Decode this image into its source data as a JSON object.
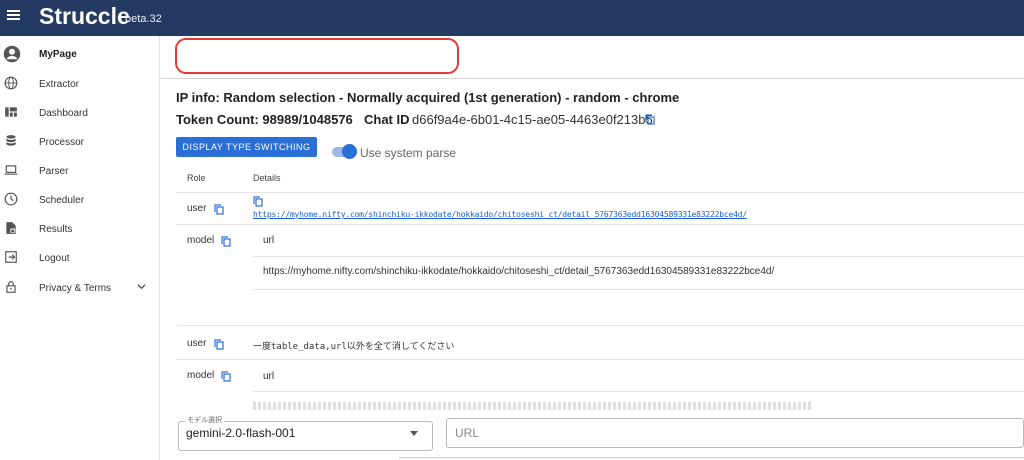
{
  "header": {
    "brand": "Struccle",
    "version": "beta.32",
    "menu_icon": "hamburger-icon"
  },
  "sidebar": {
    "items": [
      {
        "label": "MyPage",
        "icon": "account-circle-icon"
      },
      {
        "label": "Extractor",
        "icon": "globe-icon"
      },
      {
        "label": "Dashboard",
        "icon": "dashboard-icon"
      },
      {
        "label": "Processor",
        "icon": "database-icon"
      },
      {
        "label": "Parser",
        "icon": "laptop-icon"
      },
      {
        "label": "Scheduler",
        "icon": "clock-icon"
      },
      {
        "label": "Results",
        "icon": "file-lock-icon"
      },
      {
        "label": "Logout",
        "icon": "logout-icon"
      },
      {
        "label": "Privacy & Terms",
        "icon": "lock-icon"
      }
    ]
  },
  "main": {
    "ip_info": "IP info: Random selection - Normally acquired (1st generation) - random - chrome",
    "token_count": "Token Count: 98989/1048576",
    "chat_id_label": "Chat ID",
    "chat_id": "d66f9a4e-6b01-4c15-ae05-4463e0f213b5",
    "display_switch_button": "DISPLAY TYPE SWITCHING",
    "system_parse_label": "Use system parse",
    "table": {
      "headers": {
        "role": "Role",
        "details": "Details"
      },
      "rows": [
        {
          "role": "user",
          "details": "https://myhome.nifty.com/shinchiku-ikkodate/hokkaido/chitoseshi_ct/detail_5767363edd16304589331e83222bce4d/"
        },
        {
          "role": "model",
          "details_header": "url",
          "details": "https://myhome.nifty.com/shinchiku-ikkodate/hokkaido/chitoseshi_ct/detail_5767363edd16304589331e83222bce4d/"
        },
        {
          "role": "user",
          "details": "一度table_data,url以外を全て消してください"
        },
        {
          "role": "model",
          "details_header": "url"
        }
      ]
    },
    "model_select": {
      "legend": "モデル選択",
      "value": "gemini-2.0-flash-001"
    },
    "url_input": {
      "placeholder": "URL"
    }
  }
}
